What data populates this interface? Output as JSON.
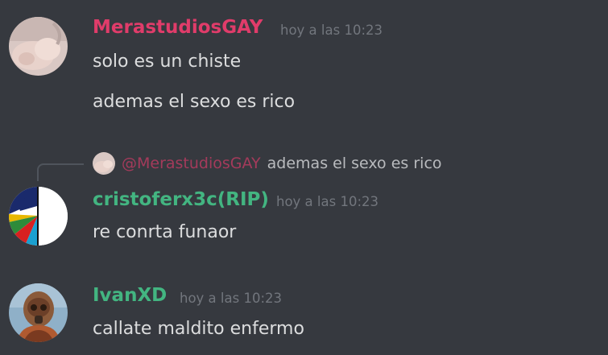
{
  "messages": [
    {
      "author": "MerastudiosGAY",
      "author_color": "#e03c6a",
      "timestamp": "hoy a las 10:23",
      "lines": [
        "solo es un chiste",
        "ademas el sexo es rico"
      ]
    },
    {
      "reply": {
        "author": "@MerastudiosGAY",
        "text": "ademas el sexo es rico"
      },
      "author": "cristoferx3c(RIP)",
      "author_color": "#43b581",
      "timestamp": "hoy a las 10:23",
      "lines": [
        "re conrta funaor"
      ]
    },
    {
      "author": "IvanXD",
      "author_color": "#43b581",
      "timestamp": "hoy a las 10:23",
      "lines": [
        "callate maldito enfermo"
      ]
    }
  ]
}
